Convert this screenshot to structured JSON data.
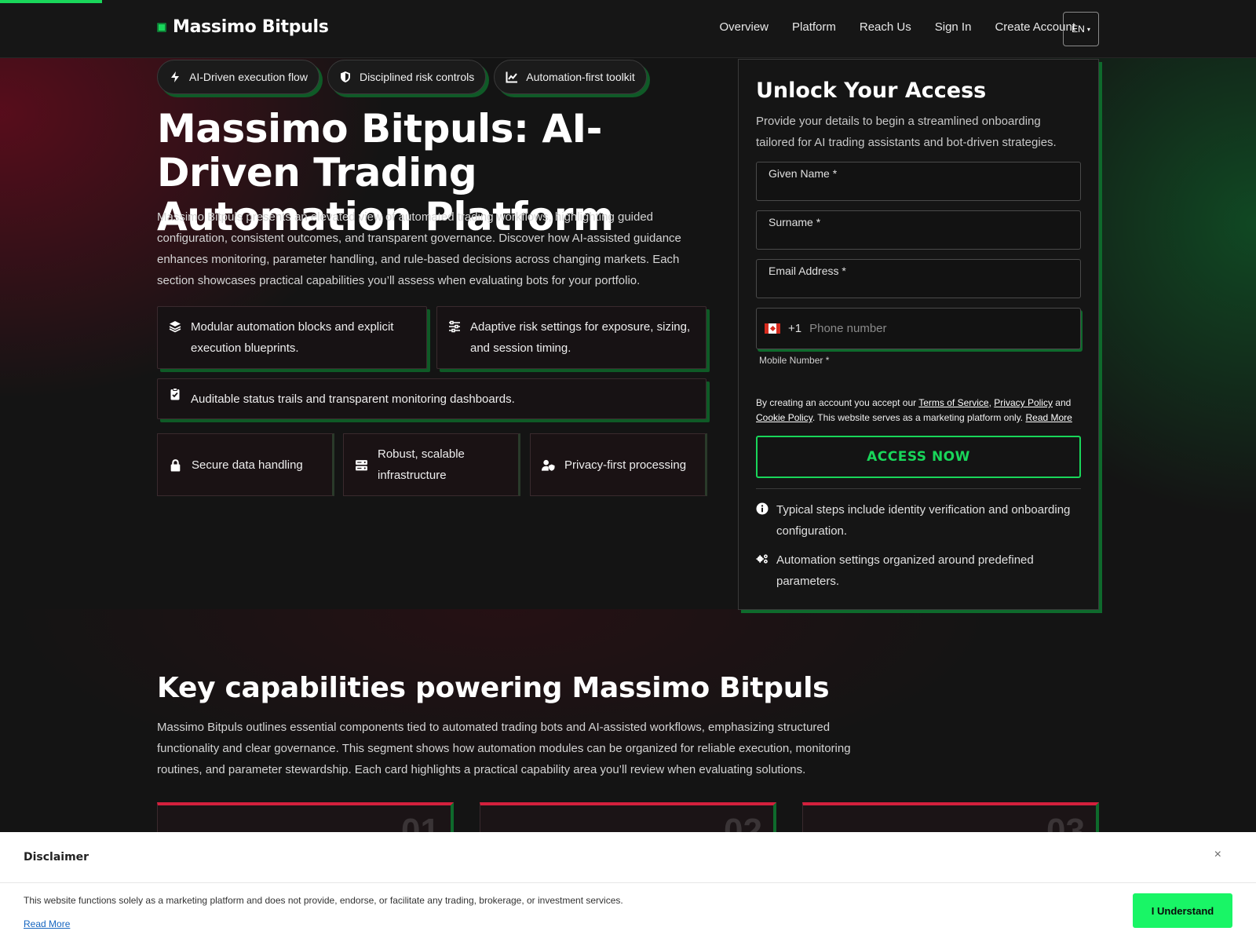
{
  "header": {
    "brand": "Massimo Bitpuls",
    "nav": [
      "Overview",
      "Platform",
      "Reach Us",
      "Sign In",
      "Create Account"
    ],
    "lang": "EN",
    "accent_color": "#19d65a"
  },
  "hero": {
    "chips": [
      {
        "label": "AI-Driven execution flow",
        "icon": "bolt-icon"
      },
      {
        "label": "Disciplined risk controls",
        "icon": "shield-icon"
      },
      {
        "label": "Automation-first toolkit",
        "icon": "chart-line-icon"
      }
    ],
    "title": "Massimo Bitpuls: AI-Driven Trading Automation Platform",
    "description": "Massimo Bitpuls presents an elevated view of automated trading workflows, highlighting guided configuration, consistent outcomes, and transparent governance. Discover how AI-assisted guidance enhances monitoring, parameter handling, and rule-based decisions across changing markets. Each section showcases practical capabilities you’ll assess when evaluating bots for your portfolio.",
    "features": [
      {
        "text": "Modular automation blocks and explicit execution blueprints.",
        "icon": "layers-icon"
      },
      {
        "text": "Adaptive risk settings for exposure, sizing, and session timing.",
        "icon": "sliders-icon"
      },
      {
        "text": "Auditable status trails and transparent monitoring dashboards.",
        "icon": "clipboard-check-icon"
      }
    ],
    "mini": [
      {
        "text": "Secure data handling",
        "icon": "lock-icon"
      },
      {
        "text": "Robust, scalable infrastructure",
        "icon": "server-icon"
      },
      {
        "text": "Privacy-first processing",
        "icon": "user-shield-icon"
      }
    ]
  },
  "form": {
    "title": "Unlock Your Access",
    "subtitle": "Provide your details to begin a streamlined onboarding tailored for AI trading assistants and bot-driven strategies.",
    "given_name": "Given Name *",
    "surname": "Surname *",
    "email": "Email Address *",
    "dial_code": "+1",
    "phone_placeholder": "Phone number",
    "mobile_label": "Mobile Number *",
    "terms_1": "By creating an account you accept our ",
    "tos": "Terms of Service",
    "comma": ", ",
    "privacy": "Privacy Policy",
    "and": " and ",
    "cookie": "Cookie Policy",
    "terms_2": ". This website serves as a marketing platform only. ",
    "read_more": "Read More",
    "button": "ACCESS NOW",
    "info": [
      {
        "text": "Typical steps include identity verification and onboarding configuration.",
        "icon": "info-icon"
      },
      {
        "text": "Automation settings organized around predefined parameters.",
        "icon": "gears-icon"
      }
    ]
  },
  "capabilities": {
    "title": "Key capabilities powering Massimo Bitpuls",
    "description": "Massimo Bitpuls outlines essential components tied to automated trading bots and AI-assisted workflows, emphasizing structured functionality and clear governance. This segment shows how automation modules can be organized for reliable execution, monitoring routines, and parameter stewardship. Each card highlights a practical capability area you’ll review when evaluating solutions.",
    "cards": [
      "01",
      "02",
      "03"
    ],
    "card_accent": "#d3203d"
  },
  "disclaimer": {
    "title": "Disclaimer",
    "close": "×",
    "text": "This website functions solely as a marketing platform and does not provide, endorse, or facilitate any trading, brokerage, or investment services.",
    "read_more": "Read More",
    "button": "I Understand",
    "button_color": "#19f566"
  }
}
